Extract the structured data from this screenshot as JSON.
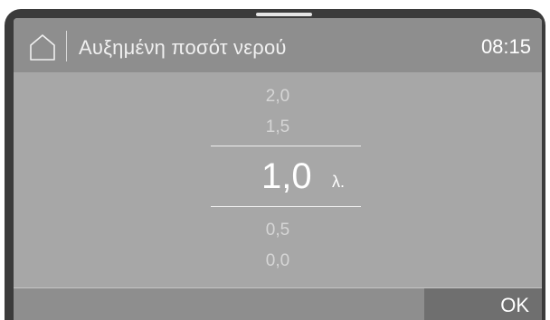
{
  "header": {
    "title": "Αυξημένη ποσότ νερού",
    "time": "08:15",
    "home_icon": "home-icon"
  },
  "picker": {
    "options": [
      "2,0",
      "1,5",
      "1,0",
      "0,5",
      "0,0"
    ],
    "above": [
      "2,0",
      "1,5"
    ],
    "current": "1,0",
    "unit": "λ.",
    "below": [
      "0,5",
      "0,0"
    ]
  },
  "footer": {
    "ok_label": "OK"
  },
  "colors": {
    "frame": "#3b3b3b",
    "screen": "#a7a7a7",
    "bar": "#8e8e8e",
    "ok_button": "#6f6f6f",
    "text": "#ffffff"
  }
}
